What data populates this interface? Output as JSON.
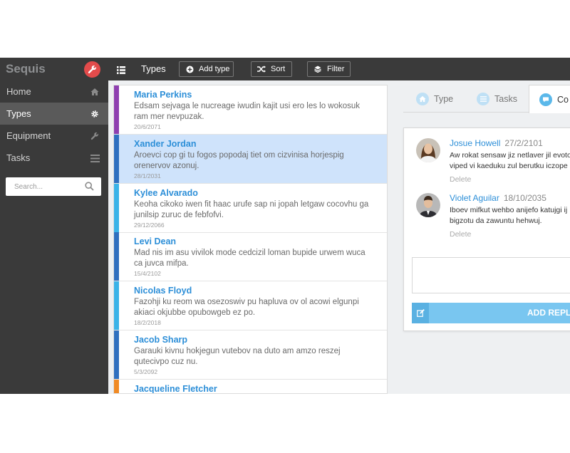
{
  "app": {
    "brand": "Sequis",
    "brand_icon": "wrench-icon",
    "accent_color": "#e34b4b"
  },
  "sidebar": {
    "items": [
      {
        "label": "Home",
        "icon": "home-icon",
        "active": false
      },
      {
        "label": "Types",
        "icon": "gear-icon",
        "active": true
      },
      {
        "label": "Equipment",
        "icon": "wrench-icon",
        "active": false
      },
      {
        "label": "Tasks",
        "icon": "list-icon",
        "active": false
      }
    ],
    "search": {
      "placeholder": "Search...",
      "value": ""
    }
  },
  "toolbar": {
    "title": "Types",
    "add_label": "Add type",
    "sort_label": "Sort",
    "filter_label": "Filter"
  },
  "list": {
    "items": [
      {
        "name": "Maria Perkins",
        "desc": "Edsam sejvaga le nucreage iwudin kajit usi ero les lo wokosuk ram mer nevpuzak.",
        "date": "20/6/2071",
        "color": "#8e3fb0",
        "selected": false
      },
      {
        "name": "Xander Jordan",
        "desc": "Aroevci cop gi tu fogos popodaj tiet om cizvinisa horjespig orenervov azonuj.",
        "date": "28/1/2031",
        "color": "#2f6fbf",
        "selected": true
      },
      {
        "name": "Kylee Alvarado",
        "desc": "Keoha cikoko iwen fit haac urufe sap ni jopah letgaw cocovhu ga junilsip zuruc de febfofvi.",
        "date": "29/12/2066",
        "color": "#3ab3e8",
        "selected": false
      },
      {
        "name": "Levi Dean",
        "desc": "Mad nis im asu vivilok mode cedcizil loman bupide urwem wuca ca juvca mifpa.",
        "date": "15/4/2102",
        "color": "#2f6fbf",
        "selected": false
      },
      {
        "name": "Nicolas Floyd",
        "desc": "Fazohji ku reom wa osezoswiv pu hapluva ov ol acowi elgunpi akiaci okjubbe opubowgeb ez po.",
        "date": "18/2/2018",
        "color": "#3ab3e8",
        "selected": false
      },
      {
        "name": "Jacob Sharp",
        "desc": "Garauki kivnu hokjegun vutebov na duto am amzo reszej qutecivpo cuz nu.",
        "date": "5/3/2092",
        "color": "#2f6fbf",
        "selected": false
      },
      {
        "name": "Jacqueline Fletcher",
        "desc": "",
        "date": "",
        "color": "#f08a24",
        "selected": false
      }
    ]
  },
  "tabs": [
    {
      "label": "Type",
      "icon": "home-icon",
      "active": false
    },
    {
      "label": "Tasks",
      "icon": "list-icon",
      "active": false
    },
    {
      "label": "Co",
      "icon": "comment-icon",
      "active": true
    }
  ],
  "comments": {
    "items": [
      {
        "author": "Josue Howell",
        "date": "27/2/2101",
        "lines": [
          "Aw rokat sensaw jiz netlaver jil evotos",
          "viped vi kaeduku zul berutku iczope p"
        ],
        "delete_label": "Delete",
        "avatar": "woman-avatar"
      },
      {
        "author": "Violet Aguilar",
        "date": "18/10/2035",
        "lines": [
          "Iboev mifkut wehbo anijefo katujgi ij",
          "bigzotu da zawuntu hehwuj."
        ],
        "delete_label": "Delete",
        "avatar": "man-avatar"
      }
    ],
    "reply_placeholder": "",
    "reply_label": "ADD REPLY"
  }
}
